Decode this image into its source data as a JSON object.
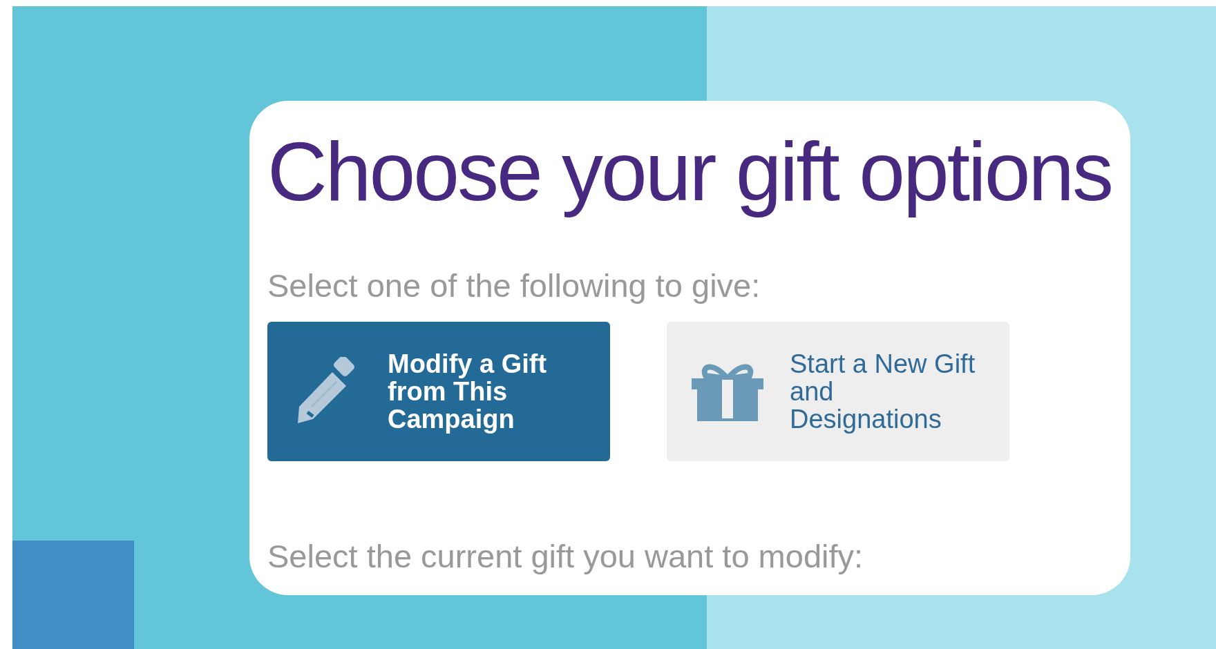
{
  "title": "Choose your gift options",
  "prompt": "Select one of the following to give:",
  "options": [
    {
      "kind": "modify",
      "label": "Modify a Gift from This Campaign",
      "selected": true
    },
    {
      "kind": "new",
      "label": "Start a New Gift and Designations",
      "selected": false
    }
  ],
  "next_prompt": "Select the current gift you want to modify:"
}
